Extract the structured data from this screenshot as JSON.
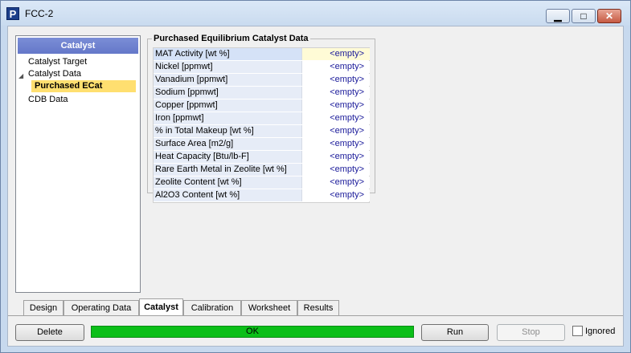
{
  "window": {
    "title": "FCC-2",
    "app_icon_letter": "P"
  },
  "tree": {
    "header": "Catalyst",
    "items": [
      {
        "label": "Catalyst Target"
      },
      {
        "label": "Catalyst Data"
      },
      {
        "label": "Purchased ECat"
      },
      {
        "label": "CDB Data"
      }
    ]
  },
  "group": {
    "title": "Purchased Equilibrium Catalyst Data",
    "rows": [
      {
        "label": "MAT Activity [wt %]",
        "value": "<empty>"
      },
      {
        "label": "Nickel [ppmwt]",
        "value": "<empty>"
      },
      {
        "label": "Vanadium [ppmwt]",
        "value": "<empty>"
      },
      {
        "label": "Sodium [ppmwt]",
        "value": "<empty>"
      },
      {
        "label": "Copper [ppmwt]",
        "value": "<empty>"
      },
      {
        "label": "Iron [ppmwt]",
        "value": "<empty>"
      },
      {
        "label": "% in Total Makeup [wt %]",
        "value": "<empty>"
      },
      {
        "label": "Surface Area [m2/g]",
        "value": "<empty>"
      },
      {
        "label": "Heat Capacity [Btu/lb-F]",
        "value": "<empty>"
      },
      {
        "label": "Rare Earth Metal in Zeolite [wt %]",
        "value": "<empty>"
      },
      {
        "label": "Zeolite Content [wt %]",
        "value": "<empty>"
      },
      {
        "label": "Al2O3 Content [wt %]",
        "value": "<empty>"
      }
    ]
  },
  "tabs": [
    {
      "label": "Design"
    },
    {
      "label": "Operating Data"
    },
    {
      "label": "Catalyst",
      "active": true
    },
    {
      "label": "Calibration"
    },
    {
      "label": "Worksheet"
    },
    {
      "label": "Results"
    }
  ],
  "footer": {
    "delete_label": "Delete",
    "status_text": "OK",
    "run_label": "Run",
    "stop_label": "Stop",
    "ignored_label": "Ignored",
    "ignored_checked": false
  },
  "colors": {
    "status_ok": "#0bbf18",
    "tree_header": "#6477c9",
    "tree_selected": "#ffdf70",
    "value_text": "#1a1a9a"
  },
  "icons": [
    "app-logo-icon",
    "minimize-icon",
    "maximize-icon",
    "close-icon",
    "expand-arrow-icon"
  ]
}
